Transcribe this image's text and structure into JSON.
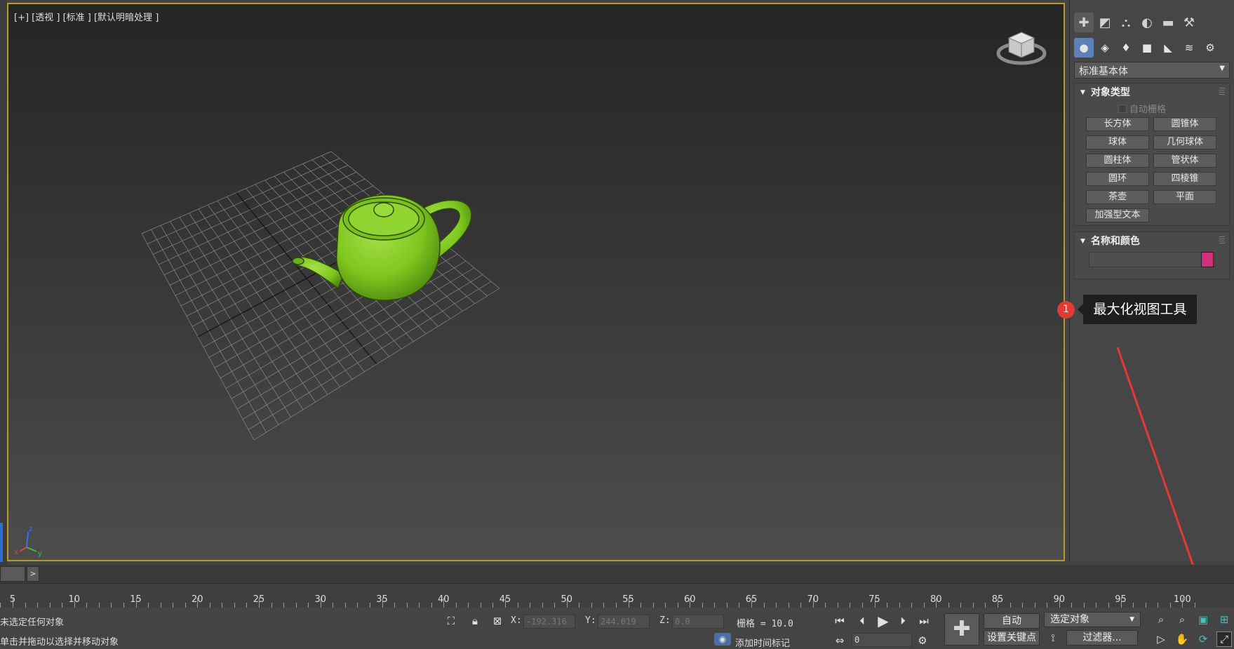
{
  "viewport": {
    "label": "[+] [透视 ] [标准 ] [默认明暗处理 ]",
    "axis_z": "z",
    "axis_x": "x",
    "axis_y": "y"
  },
  "command_panel": {
    "dropdown_value": "标准基本体",
    "object_type": {
      "title": "对象类型",
      "autogrid": "自动栅格",
      "buttons": [
        "长方体",
        "圆锥体",
        "球体",
        "几何球体",
        "圆柱体",
        "管状体",
        "圆环",
        "四棱锥",
        "茶壶",
        "平面",
        "加强型文本"
      ]
    },
    "name_color": {
      "title": "名称和颜色",
      "name_value": "",
      "color": "#d2307a"
    }
  },
  "annotation": {
    "badge": "1",
    "tooltip": "最大化视图工具"
  },
  "timeline": {
    "labels": [
      "5",
      "10",
      "15",
      "20",
      "25",
      "30",
      "35",
      "40",
      "45",
      "50",
      "55",
      "60",
      "65",
      "70",
      "75",
      "80",
      "85",
      "90",
      "95",
      "100"
    ]
  },
  "status": {
    "line1": "未选定任何对象",
    "line2": "单击并拖动以选择并移动对象",
    "x_label": "X:",
    "x_value": "-192.316",
    "y_label": "Y:",
    "y_value": "244.019",
    "z_label": "Z:",
    "z_value": "0.0",
    "grid": "栅格 = 10.0",
    "add_time_tag": "添加时间标记",
    "frame_value": "0",
    "auto_key": "自动",
    "selected_object": "选定对象",
    "set_key": "设置关键点",
    "filters": "过滤器..."
  },
  "colors": {
    "viewport_border": "#b89a2a",
    "teapot": "#7fc71f",
    "selected_tab": "#5a82b8",
    "badge": "#e53935",
    "arrow": "#e53935"
  }
}
